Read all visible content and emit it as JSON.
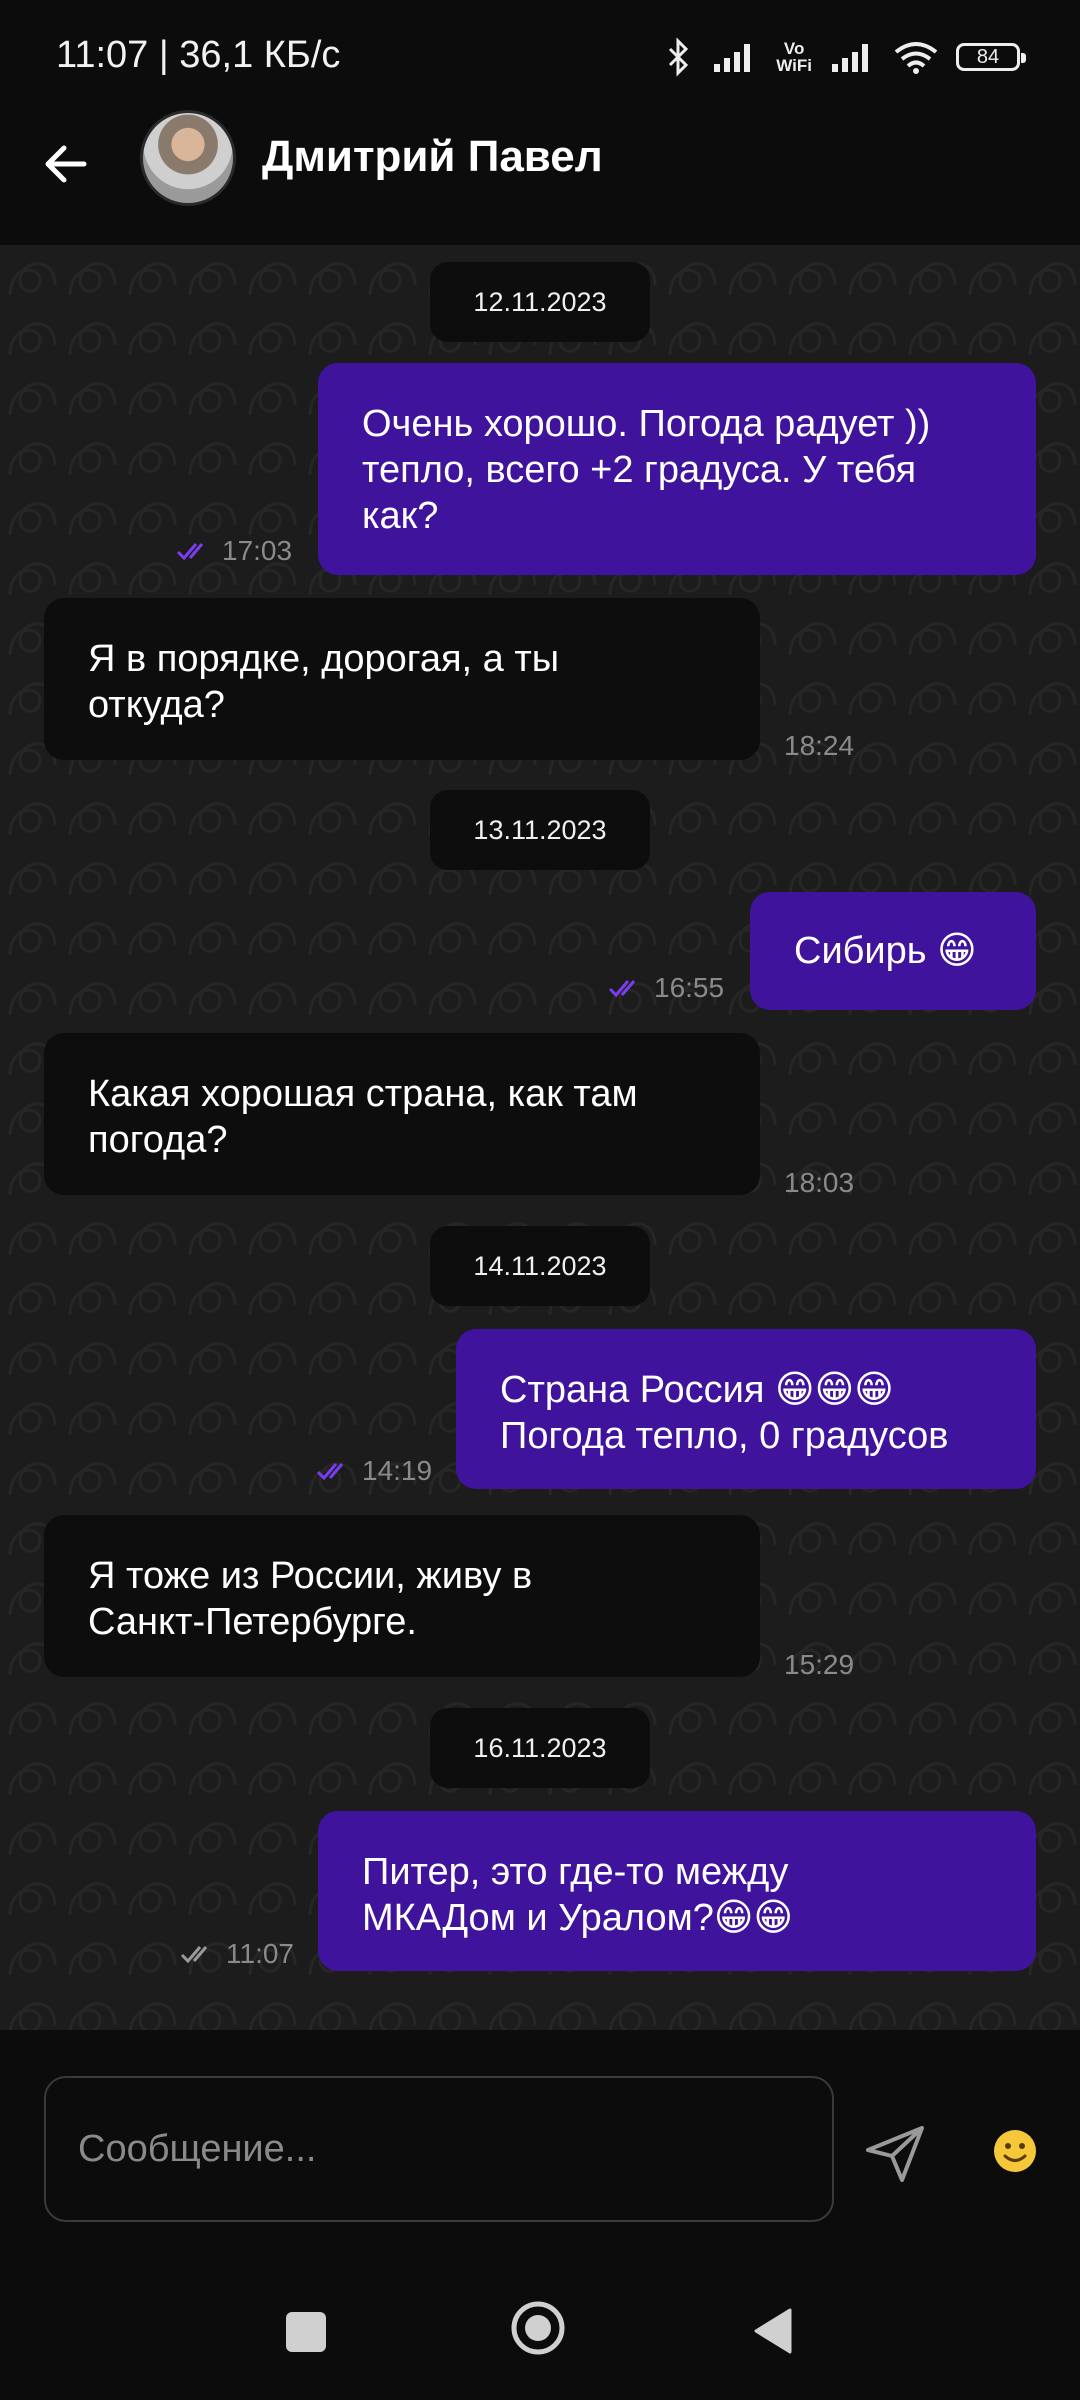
{
  "status_bar": {
    "time": "11:07 | 36,1 КБ/с",
    "battery": "84"
  },
  "header": {
    "contact_name": "Дмитрий Павел"
  },
  "messages": [
    {
      "type": "date",
      "text": "12.11.2023"
    },
    {
      "type": "out",
      "lines": [
        "Очень хорошо. Погода радует ))",
        "тепло, всего +2 градуса. У тебя",
        "как?"
      ],
      "time": "17:03",
      "read": true
    },
    {
      "type": "in",
      "lines": [
        "Я в порядке, дорогая, а ты",
        "откуда?"
      ],
      "time": "18:24"
    },
    {
      "type": "date",
      "text": "13.11.2023"
    },
    {
      "type": "out",
      "lines": [
        "Сибирь 😁"
      ],
      "time": "16:55",
      "read": true
    },
    {
      "type": "in",
      "lines": [
        "Какая хорошая страна, как там",
        "погода?"
      ],
      "time": "18:03"
    },
    {
      "type": "date",
      "text": "14.11.2023"
    },
    {
      "type": "out",
      "lines": [
        "Страна Россия 😁😁😁",
        "Погода тепло, 0 градусов"
      ],
      "time": "14:19",
      "read": true
    },
    {
      "type": "in",
      "lines": [
        "Я тоже из России, живу в",
        "Санкт-Петербурге."
      ],
      "time": "15:29"
    },
    {
      "type": "date",
      "text": "16.11.2023"
    },
    {
      "type": "out",
      "lines": [
        "Питер, это где-то между",
        "МКАДом и  Уралом?😁😁"
      ],
      "time": "11:07",
      "read": false
    }
  ],
  "input": {
    "placeholder": "Сообщение..."
  },
  "colors": {
    "outgoing_bubble": "#3f139b",
    "incoming_bubble": "#0d0d0d",
    "read_check": "#7a3cf0",
    "sent_check": "#9a9a9a"
  },
  "icons": {
    "back": "arrow-left-icon",
    "send": "paper-plane-icon",
    "emoji": "smile-emoji-icon",
    "status": [
      "bluetooth-icon",
      "signal-icon",
      "vowifi-icon",
      "signal-icon",
      "wifi-icon",
      "battery-icon"
    ],
    "nav": [
      "square-icon",
      "circle-icon",
      "triangle-back-icon"
    ]
  }
}
